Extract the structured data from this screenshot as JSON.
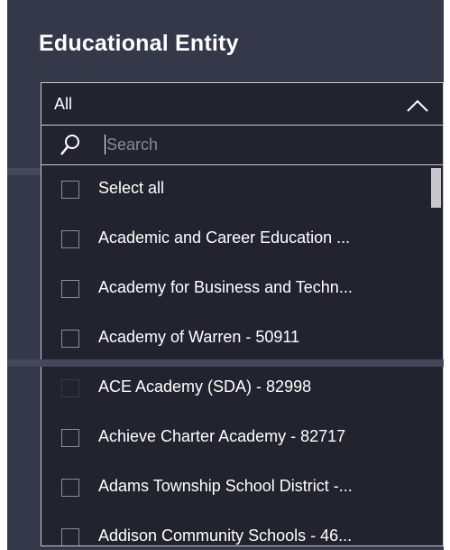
{
  "filter": {
    "title": "Educational Entity",
    "selected_value": "All",
    "chevron_icon": "chevron-up-icon",
    "search": {
      "placeholder": "Search",
      "icon": "search-icon"
    },
    "items": [
      {
        "label": "Select all",
        "checked": false
      },
      {
        "label": "Academic and Career Education ...",
        "checked": false
      },
      {
        "label": "Academy for Business and Techn...",
        "checked": false
      },
      {
        "label": "Academy of Warren - 50911",
        "checked": false
      },
      {
        "label": "ACE Academy (SDA) - 82998",
        "checked": false
      },
      {
        "label": "Achieve Charter Academy - 82717",
        "checked": false
      },
      {
        "label": "Adams Township School District -...",
        "checked": false
      },
      {
        "label": "Addison Community Schools - 46...",
        "checked": false
      }
    ]
  },
  "colors": {
    "panel_bg": "#353849",
    "dropdown_bg": "#23232f",
    "text": "#ffffff",
    "border": "#c8c8cc"
  }
}
